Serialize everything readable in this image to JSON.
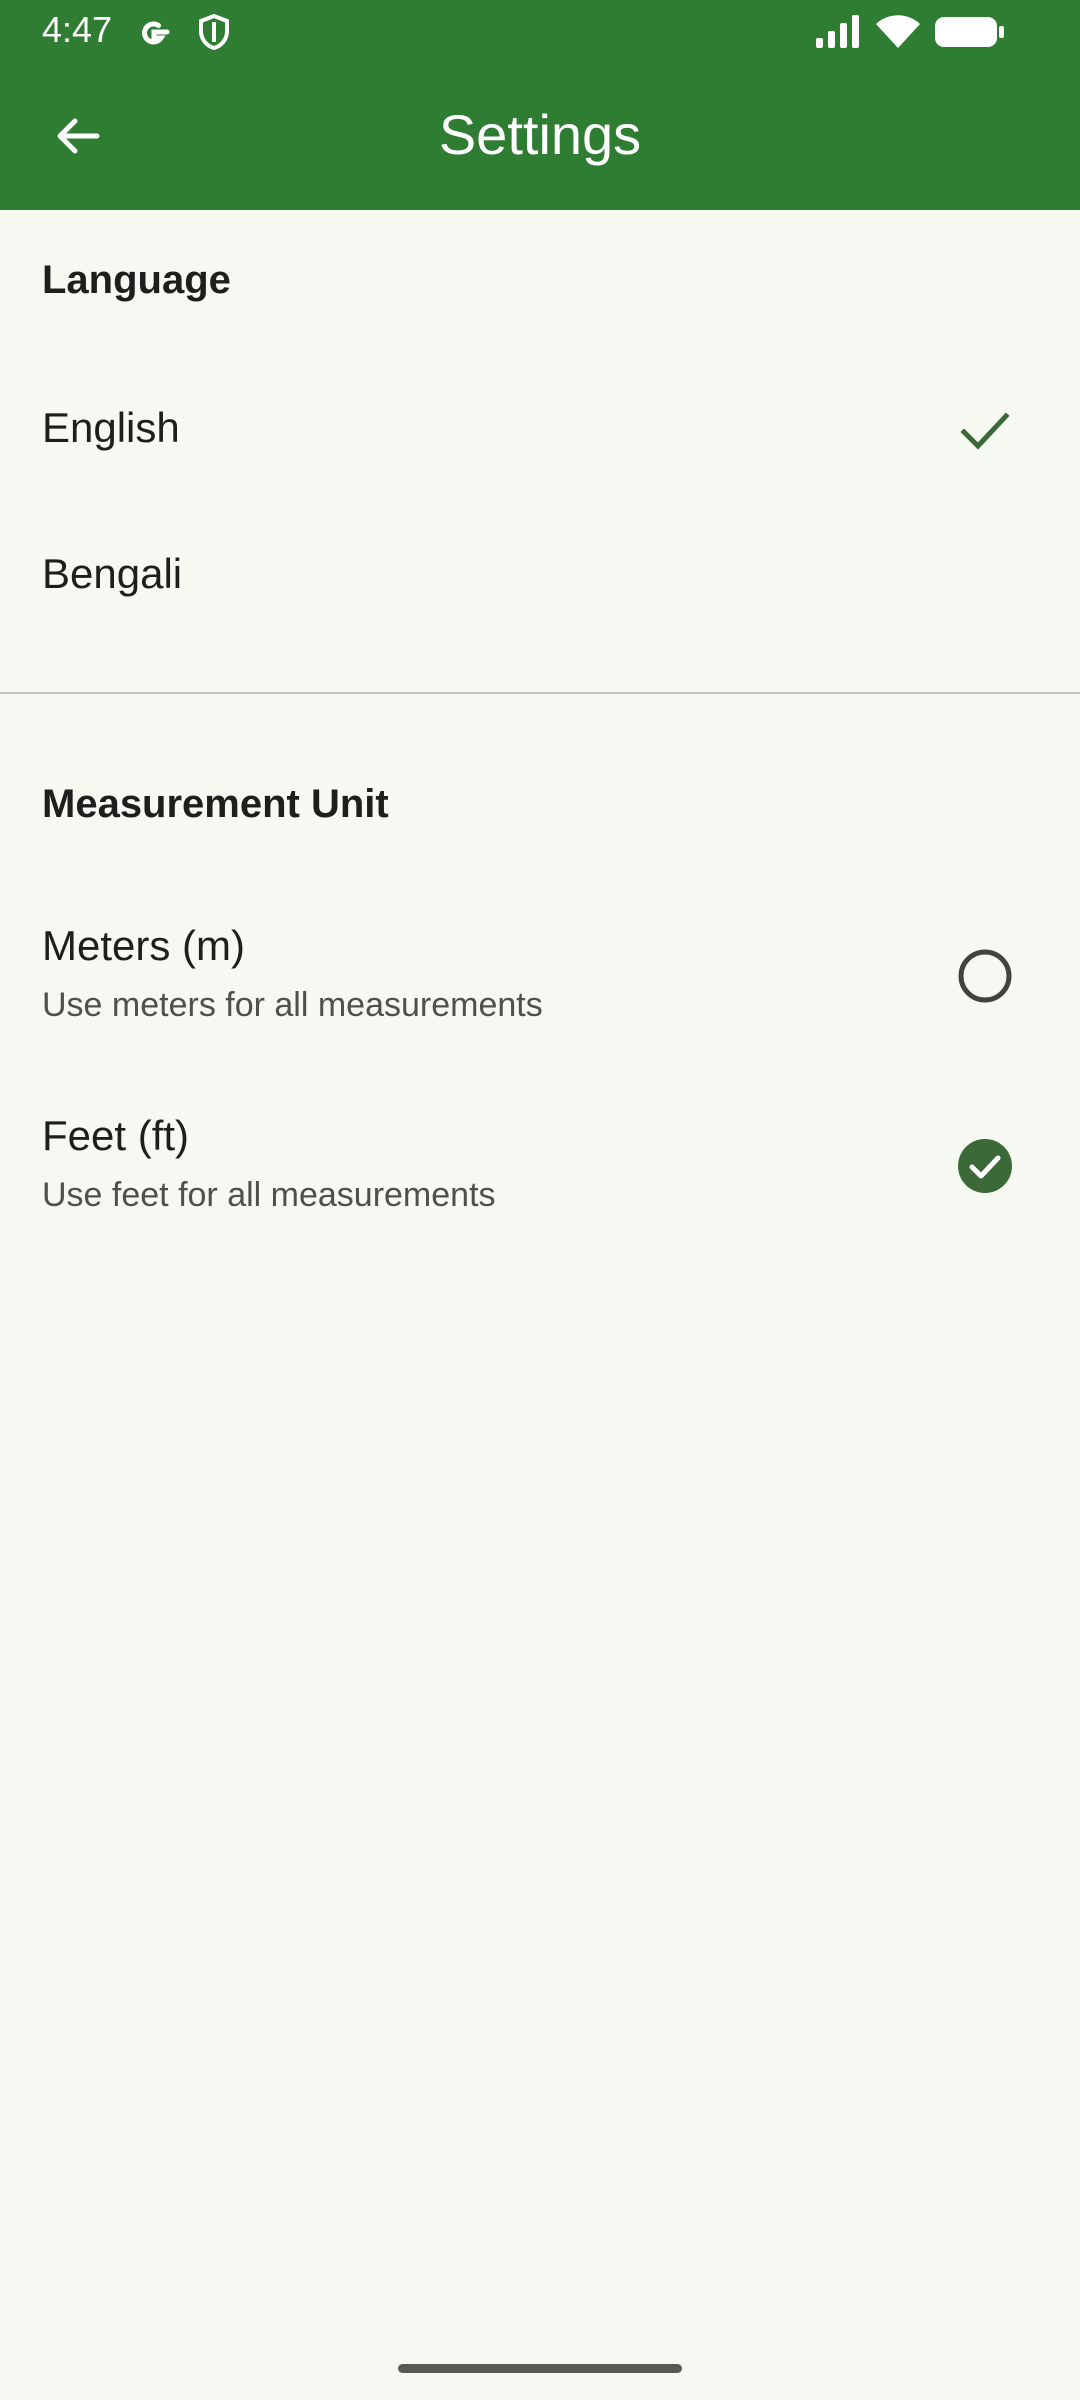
{
  "status_bar": {
    "time": "4:47",
    "icons": [
      "google-icon",
      "shield-icon",
      "signal-icon",
      "wifi-icon",
      "battery-icon"
    ]
  },
  "app_bar": {
    "title": "Settings",
    "back_icon": "arrow-left-icon"
  },
  "language": {
    "header": "Language",
    "options": [
      {
        "label": "English",
        "selected": true
      },
      {
        "label": "Bengali",
        "selected": false
      }
    ]
  },
  "measurement": {
    "header": "Measurement Unit",
    "options": [
      {
        "label": "Meters (m)",
        "description": "Use meters for all measurements",
        "selected": false
      },
      {
        "label": "Feet (ft)",
        "description": "Use feet for all measurements",
        "selected": true
      }
    ]
  },
  "colors": {
    "primary": "#2f7d32",
    "check": "#3b6a38",
    "background": "#f6f9f1"
  }
}
